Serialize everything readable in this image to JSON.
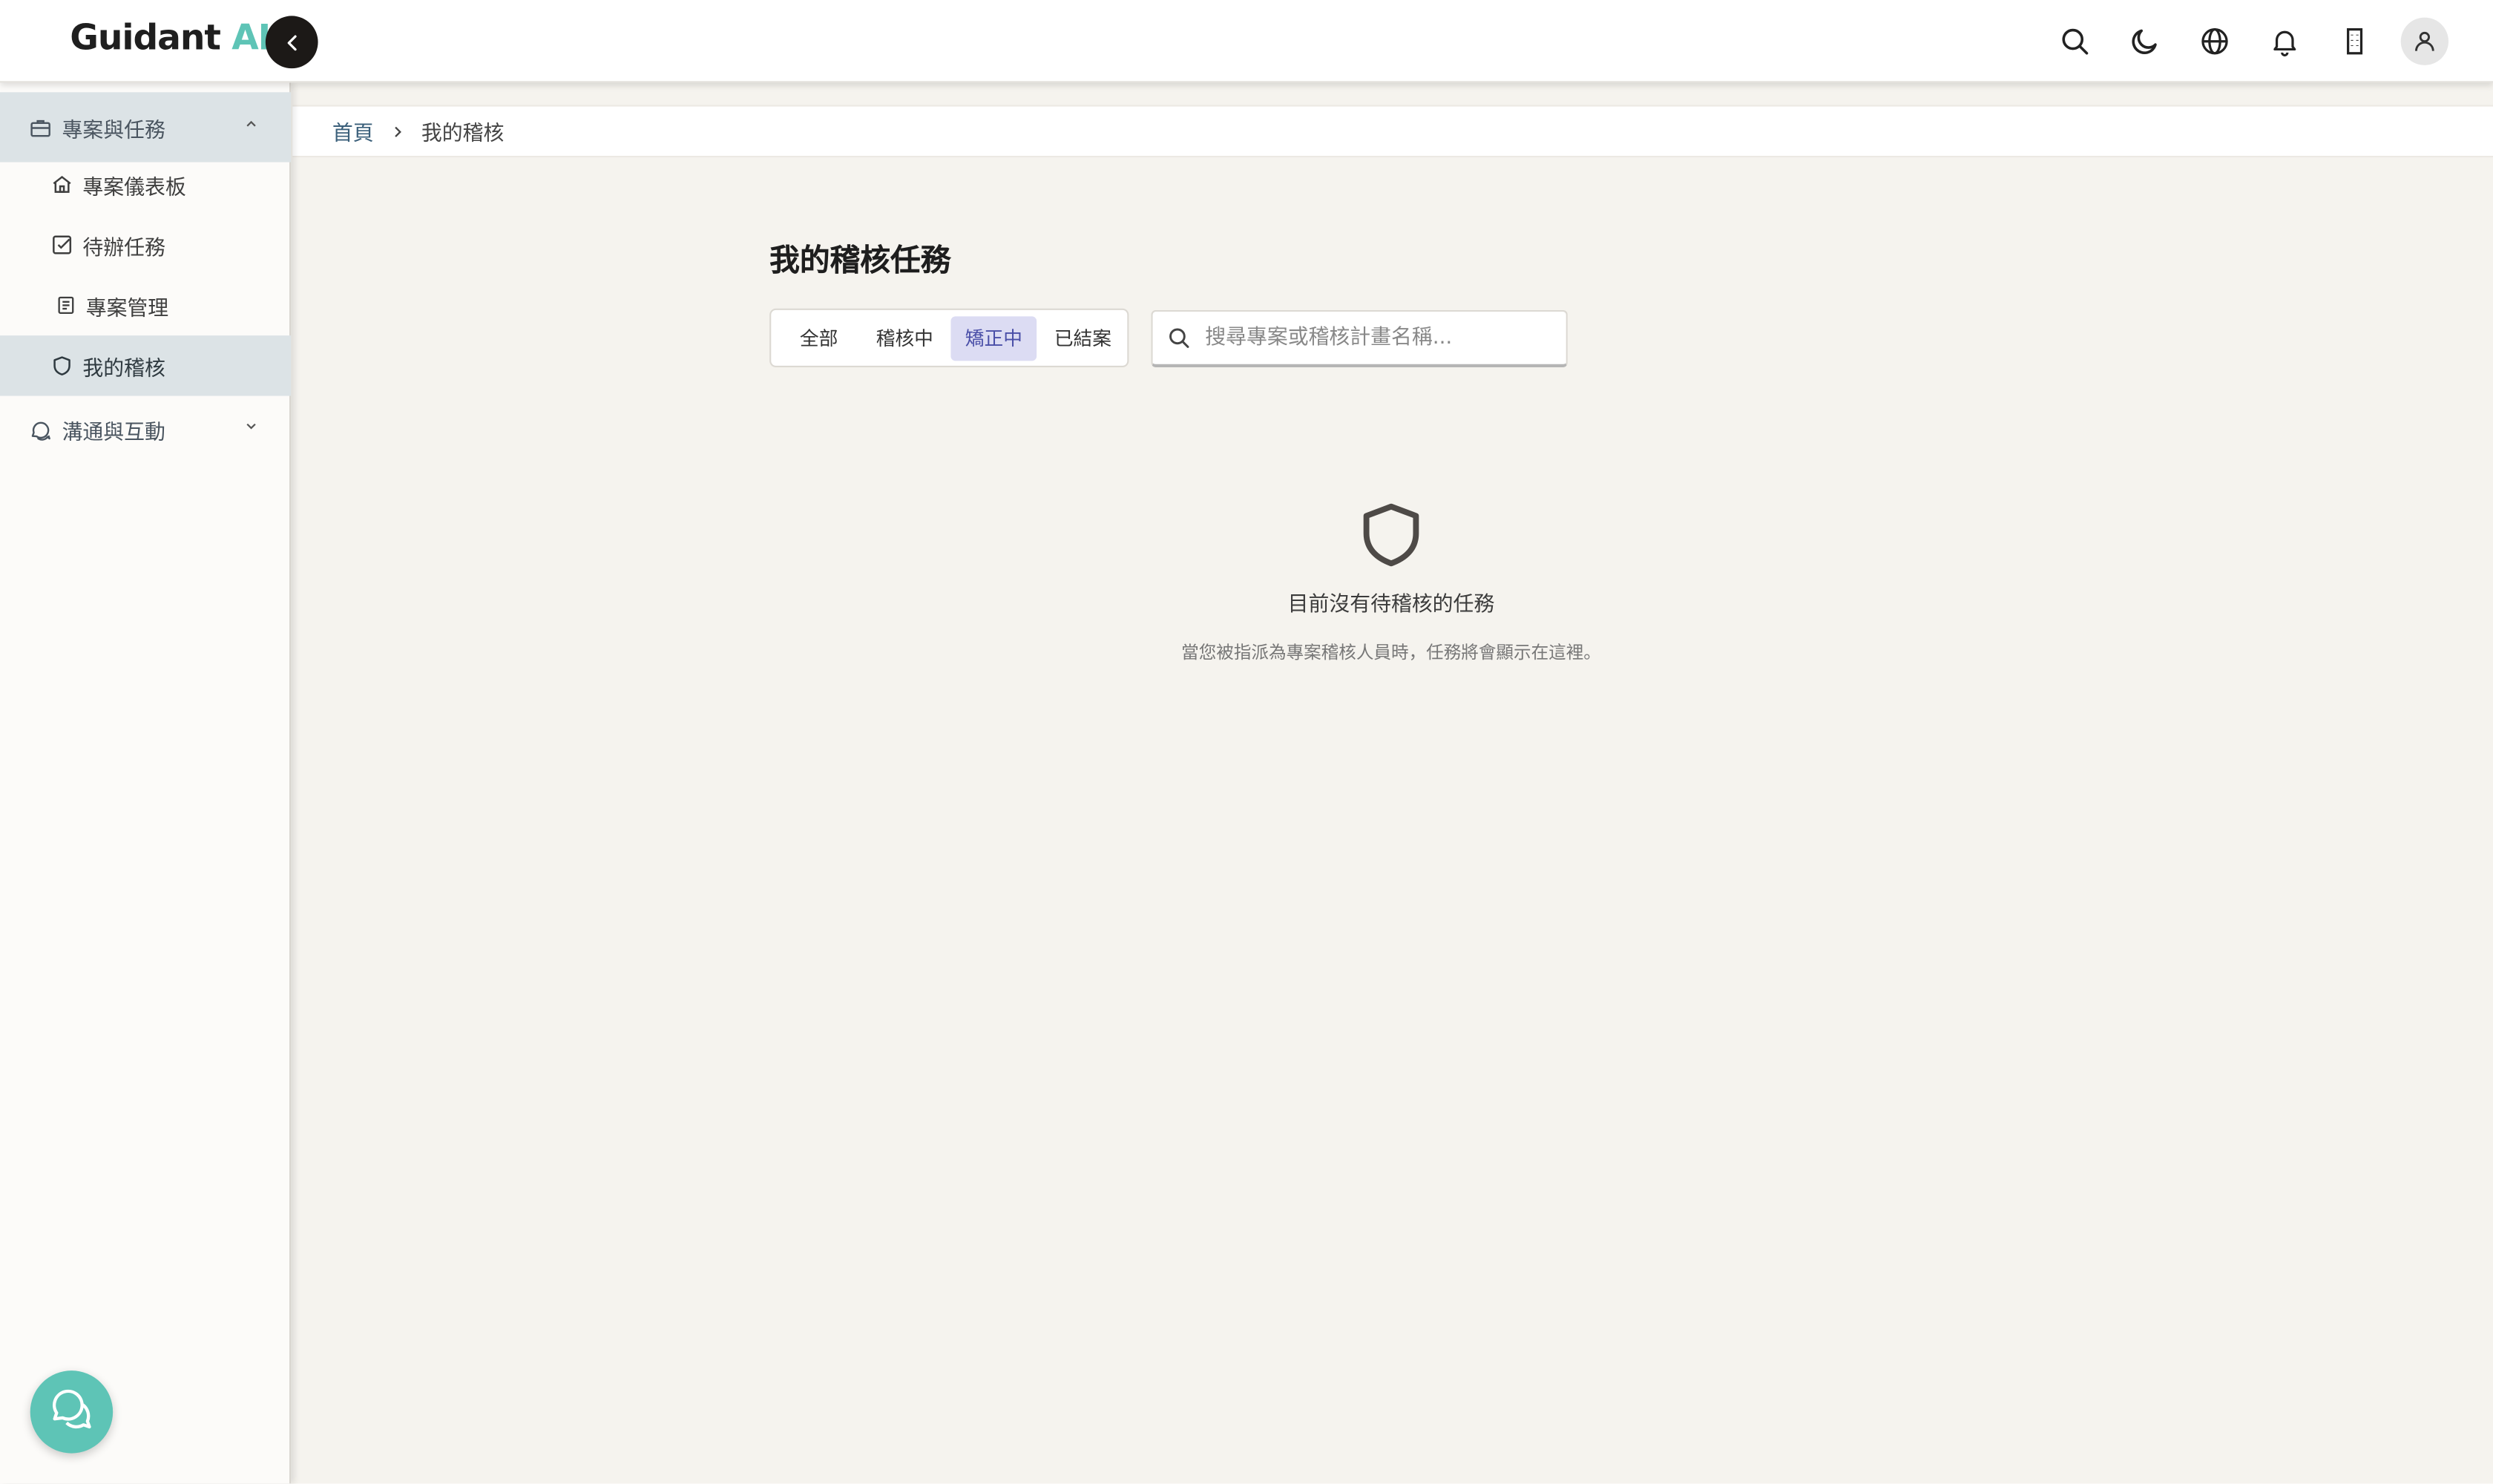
{
  "brand": {
    "name": "Guidant",
    "suffix": "AI",
    "accent_color": "#5ec4b6"
  },
  "header": {
    "icons": [
      "search-icon",
      "moon-icon",
      "globe-icon",
      "bell-icon",
      "building-icon",
      "user-icon"
    ]
  },
  "sidebar": {
    "groups": [
      {
        "label": "專案與任務",
        "icon": "briefcase-icon",
        "expanded": true,
        "items": [
          {
            "label": "專案儀表板",
            "icon": "home-icon"
          },
          {
            "label": "待辦任務",
            "icon": "checkbox-icon"
          },
          {
            "label": "專案管理",
            "icon": "document-icon"
          },
          {
            "label": "我的稽核",
            "icon": "shield-icon",
            "active": true
          }
        ]
      },
      {
        "label": "溝通與互動",
        "icon": "chat-icon",
        "expanded": false
      }
    ],
    "chat_fab_icon": "chat-bubbles-icon"
  },
  "breadcrumb": {
    "home": "首頁",
    "current": "我的稽核"
  },
  "main": {
    "title": "我的稽核任務",
    "tabs": [
      {
        "label": "全部"
      },
      {
        "label": "稽核中"
      },
      {
        "label": "矯正中",
        "active": true
      },
      {
        "label": "已結案"
      }
    ],
    "search": {
      "placeholder": "搜尋專案或稽核計畫名稱...",
      "value": ""
    },
    "empty": {
      "icon": "shield-icon",
      "title": "目前沒有待稽核的任務",
      "subtitle": "當您被指派為專案稽核人員時，任務將會顯示在這裡。"
    }
  },
  "colors": {
    "page_bg": "#f5f3ee",
    "sidebar_active": "#dce3e6",
    "tab_active_bg": "#dcdcf3",
    "tab_active_text": "#4a4fa8",
    "dark_button": "#1c1917"
  }
}
